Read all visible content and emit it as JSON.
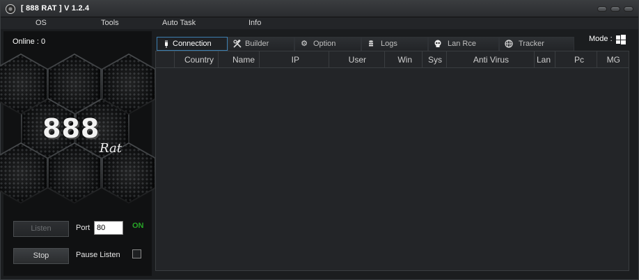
{
  "window": {
    "title": "[  888 RAT  ] V 1.2.4"
  },
  "menu": [
    "OS",
    "Tools",
    "Auto Task",
    "Info"
  ],
  "left": {
    "online_label": "Online : 0",
    "logo_text": "888",
    "logo_sub": "Rat",
    "listen_label": "Listen",
    "port_label": "Port",
    "port_value": "80",
    "status_on": "ON",
    "stop_label": "Stop",
    "pause_label": "Pause Listen",
    "pause_checked": false
  },
  "tabs": [
    {
      "label": "Connection",
      "icon": "plug-icon",
      "active": true
    },
    {
      "label": "Builder",
      "icon": "tools-icon",
      "active": false
    },
    {
      "label": "Option",
      "icon": "gear-icon",
      "active": false
    },
    {
      "label": "Logs",
      "icon": "logs-icon",
      "active": false
    },
    {
      "label": "Lan Rce",
      "icon": "skull-icon",
      "active": false
    },
    {
      "label": "Tracker",
      "icon": "globe-icon",
      "active": false
    }
  ],
  "mode": {
    "label": "Mode :",
    "icon": "windows-icon"
  },
  "table": {
    "columns": [
      "Country",
      "Name",
      "IP",
      "User",
      "Win",
      "Sys",
      "Anti Virus",
      "Lan",
      "Pc",
      "MG"
    ],
    "rows": []
  },
  "colors": {
    "on_status": "#27a527",
    "active_tab_border": "#3c7fb1",
    "background": "#1b1d1f"
  }
}
